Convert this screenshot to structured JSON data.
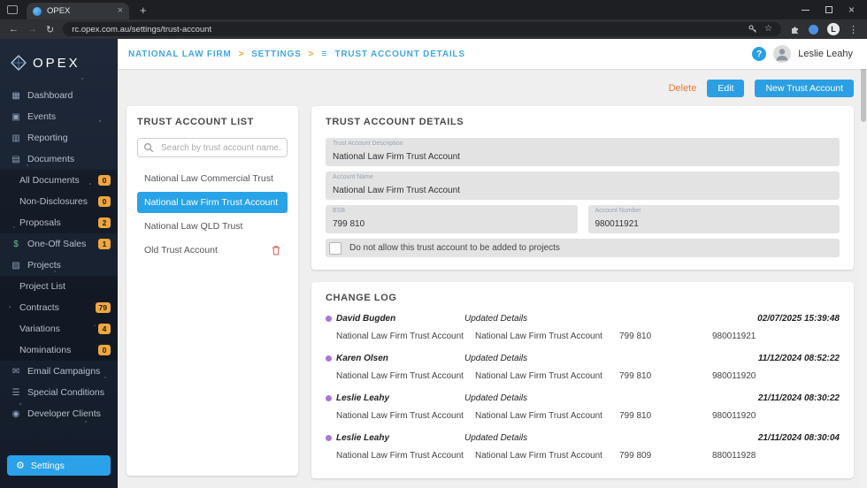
{
  "browser": {
    "tab": {
      "title": "OPEX"
    },
    "url": "rc.opex.com.au/settings/trust-account",
    "profile_initial": "L"
  },
  "header": {
    "breadcrumb": [
      "NATIONAL LAW FIRM",
      "SETTINGS",
      "TRUST ACCOUNT DETAILS"
    ],
    "help_label": "?",
    "user_name": "Leslie Leahy"
  },
  "actions": {
    "delete_label": "Delete",
    "edit_label": "Edit",
    "new_trust_account_label": "New Trust Account"
  },
  "sidebar": {
    "logo_text": "OPEX",
    "items": [
      {
        "label": "Dashboard",
        "icon": "dashboard-icon"
      },
      {
        "label": "Events",
        "icon": "events-icon"
      },
      {
        "label": "Reporting",
        "icon": "reporting-icon"
      },
      {
        "label": "Documents",
        "icon": "documents-icon"
      },
      {
        "label": "All Documents",
        "badge": "0"
      },
      {
        "label": "Non-Disclosures",
        "badge": "0"
      },
      {
        "label": "Proposals",
        "badge": "2"
      },
      {
        "label": "One-Off Sales",
        "icon": "one-off-sales-icon",
        "badge": "1"
      },
      {
        "label": "Projects",
        "icon": "projects-icon"
      },
      {
        "label": "Project List"
      },
      {
        "label": "Contracts",
        "badge": "79"
      },
      {
        "label": "Variations",
        "badge": "4"
      },
      {
        "label": "Nominations",
        "badge": "0"
      },
      {
        "label": "Email Campaigns",
        "icon": "email-campaigns-icon"
      },
      {
        "label": "Special Conditions",
        "icon": "special-conditions-icon"
      },
      {
        "label": "Developer Clients",
        "icon": "developer-clients-icon"
      }
    ],
    "settings_label": "Settings"
  },
  "trust_list": {
    "title": "TRUST ACCOUNT LIST",
    "search_placeholder": "Search by trust account name...",
    "items": [
      {
        "label": "National Law Commercial Trust",
        "selected": false
      },
      {
        "label": "National Law Firm Trust Account",
        "selected": true
      },
      {
        "label": "National Law QLD Trust",
        "selected": false
      },
      {
        "label": "Old Trust Account",
        "selected": false,
        "deletable": true
      }
    ]
  },
  "details": {
    "title": "TRUST ACCOUNT DETAILS",
    "fields": [
      {
        "label": "Trust Account Description",
        "value": "National Law Firm Trust Account"
      },
      {
        "label": "Account Name",
        "value": "National Law Firm Trust Account"
      },
      {
        "label": "BSB",
        "value": "799 810"
      },
      {
        "label": "Account Number",
        "value": "980011921"
      }
    ],
    "checkbox_label": "Do not allow this trust account to be added to projects",
    "checkbox_checked": false
  },
  "change_log": {
    "title": "CHANGE LOG",
    "entries": [
      {
        "user": "David Bugden",
        "action": "Updated Details",
        "timestamp": "02/07/2025 15:39:48",
        "description": "National Law Firm Trust Account",
        "account_name": "National Law Firm Trust Account",
        "bsb": "799 810",
        "account_number": "980011921"
      },
      {
        "user": "Karen Olsen",
        "action": "Updated Details",
        "timestamp": "11/12/2024 08:52:22",
        "description": "National Law Firm Trust Account",
        "account_name": "National Law Firm Trust Account",
        "bsb": "799 810",
        "account_number": "980011920"
      },
      {
        "user": "Leslie Leahy",
        "action": "Updated Details",
        "timestamp": "21/11/2024 08:30:22",
        "description": "National Law Firm Trust Account",
        "account_name": "National Law Firm Trust Account",
        "bsb": "799 810",
        "account_number": "980011920"
      },
      {
        "user": "Leslie Leahy",
        "action": "Updated Details",
        "timestamp": "21/11/2024 08:30:04",
        "description": "National Law Firm Trust Account",
        "account_name": "National Law Firm Trust Account",
        "bsb": "799 809",
        "account_number": "880011928"
      }
    ]
  },
  "colors": {
    "accent_blue": "#2b9fe3",
    "selected_item_blue": "#29a3e8",
    "delete_orange": "#ee7d2f",
    "badge_amber": "#efa73e",
    "breadcrumb_separator_orange": "#f0a030",
    "log_dot_purple": "#a678d8",
    "sidebar_navy": "#1a2433"
  }
}
